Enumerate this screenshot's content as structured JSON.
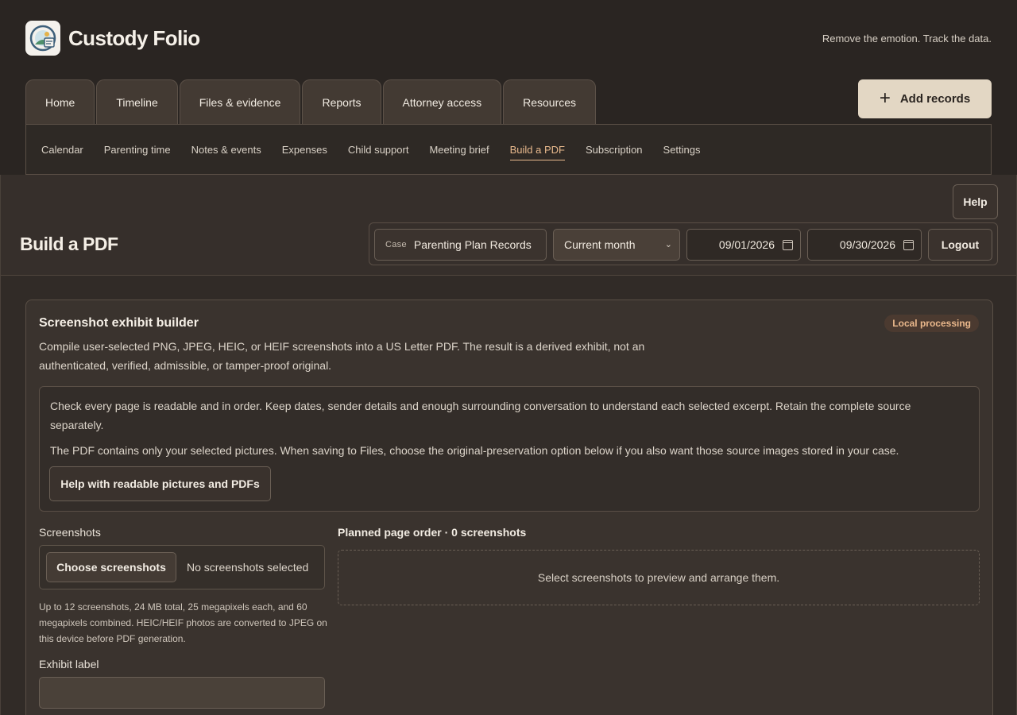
{
  "app": {
    "title": "Custody Folio",
    "tagline": "Remove the emotion. Track the data."
  },
  "main_tabs": [
    {
      "label": "Home"
    },
    {
      "label": "Timeline"
    },
    {
      "label": "Files & evidence"
    },
    {
      "label": "Reports"
    },
    {
      "label": "Attorney access"
    },
    {
      "label": "Resources"
    }
  ],
  "add_records": {
    "icon": "plus-icon",
    "label": "Add records"
  },
  "sub_nav": [
    {
      "label": "Calendar"
    },
    {
      "label": "Parenting time"
    },
    {
      "label": "Notes & events"
    },
    {
      "label": "Expenses"
    },
    {
      "label": "Child support"
    },
    {
      "label": "Meeting brief"
    },
    {
      "label": "Build a PDF",
      "active": true
    },
    {
      "label": "Subscription"
    },
    {
      "label": "Settings"
    }
  ],
  "page": {
    "title": "Build a PDF",
    "help_label": "Help",
    "case_key": "Case",
    "case_value": "Parenting Plan Records",
    "range_selected": "Current month",
    "date_from": "09/01/2026",
    "date_to": "09/30/2026",
    "logout_label": "Logout"
  },
  "builder": {
    "title": "Screenshot exhibit builder",
    "badge": "Local processing",
    "description": "Compile user-selected PNG, JPEG, HEIC, or HEIF screenshots into a US Letter PDF. The result is a derived exhibit, not an authenticated, verified, admissible, or tamper-proof original.",
    "notice_1": "Check every page is readable and in order. Keep dates, sender details and enough surrounding conversation to understand each selected excerpt. Retain the complete source separately.",
    "notice_2": "The PDF contains only your selected pictures. When saving to Files, choose the original-preservation option below if you also want those source images stored in your case.",
    "help_pictures_label": "Help with readable pictures and PDFs",
    "screenshots_label": "Screenshots",
    "choose_label": "Choose screenshots",
    "no_selection": "No screenshots selected",
    "limits": "Up to 12 screenshots, 24 MB total, 25 megapixels each, and 60 megapixels combined. HEIC/HEIF photos are converted to JPEG on this device before PDF generation.",
    "exhibit_label": "Exhibit label",
    "exhibit_value": "",
    "order_heading": "Planned page order · 0 screenshots",
    "order_empty": "Select screenshots to preview and arrange them."
  },
  "colors": {
    "background": "#2a2522",
    "accent": "#e8b98d",
    "primary_button": "#e3d7c4"
  }
}
